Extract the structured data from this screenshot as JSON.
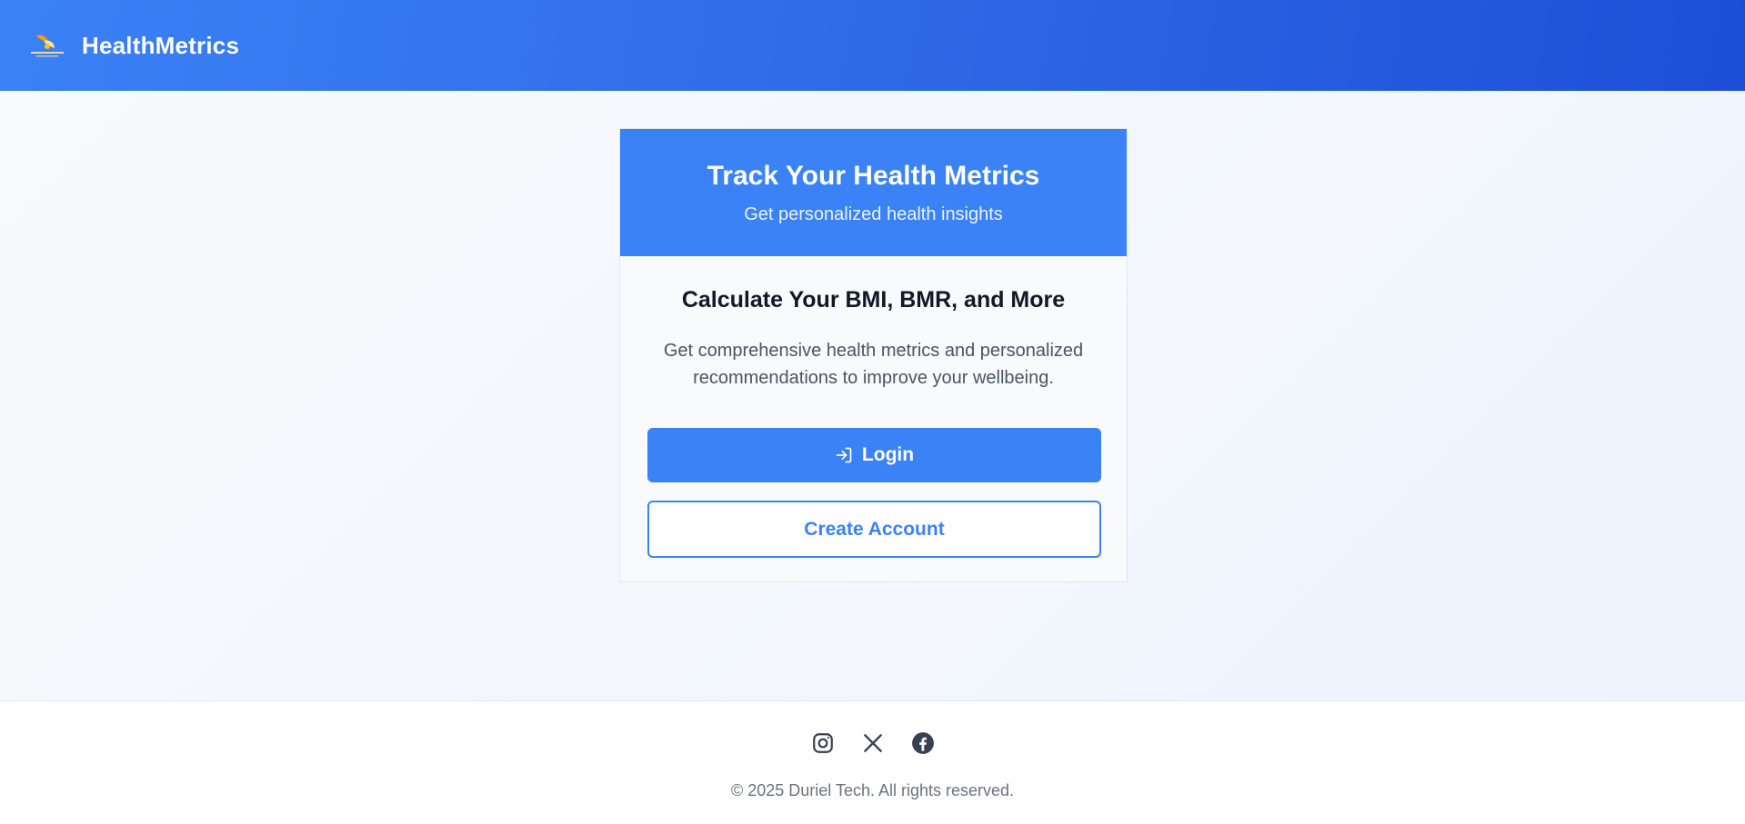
{
  "header": {
    "brand": "HealthMetrics",
    "logo_icon": "duriel-tech-logo"
  },
  "card": {
    "title": "Track Your Health Metrics",
    "subtitle": "Get personalized health insights",
    "heading": "Calculate Your BMI, BMR, and More",
    "description": "Get comprehensive health metrics and personalized recommendations to improve your wellbeing.",
    "login_label": "Login",
    "login_icon": "login-icon",
    "create_label": "Create Account"
  },
  "footer": {
    "socials": [
      "instagram-icon",
      "x-icon",
      "facebook-icon"
    ],
    "copyright": "© 2025 Duriel Tech. All rights reserved."
  },
  "colors": {
    "primary": "#3b82f6",
    "header_end": "#1d4ed8",
    "text_dark": "#111827",
    "text_muted": "#6b7280"
  }
}
